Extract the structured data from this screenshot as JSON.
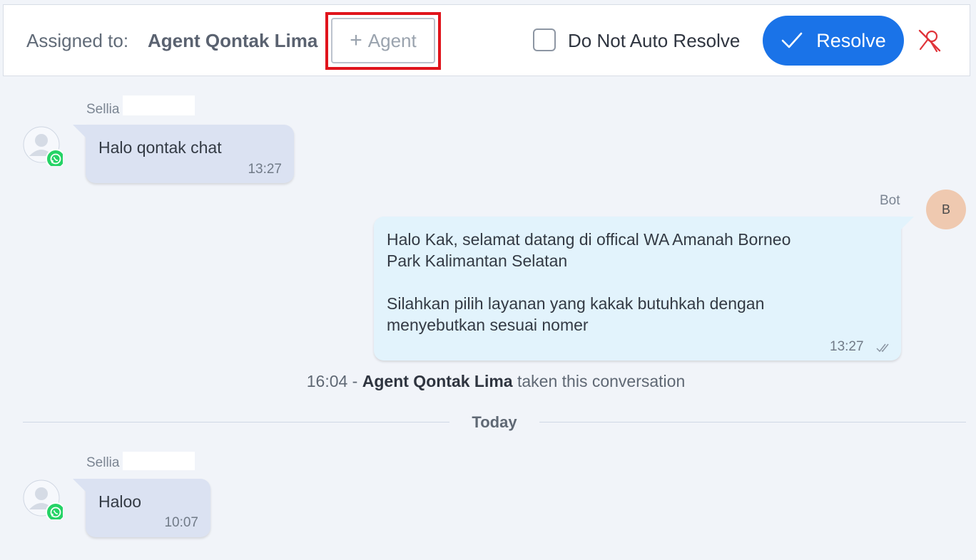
{
  "header": {
    "assigned_label": "Assigned to:",
    "assigned_agent": "Agent Qontak Lima",
    "add_agent_plus": "+",
    "add_agent_label": "Agent",
    "do_not_auto_resolve_label": "Do Not Auto Resolve",
    "do_not_auto_resolve_checked": false,
    "resolve_label": "Resolve",
    "accent_color": "#1a73e8",
    "highlight_color": "#e0141c",
    "icons": [
      "check-icon",
      "unassign-agent-icon"
    ]
  },
  "messages": [
    {
      "sender": "Sellia",
      "direction": "incoming",
      "channel": "whatsapp",
      "text": "Halo qontak chat",
      "time": "13:27"
    },
    {
      "sender": "Bot",
      "avatar_initial": "B",
      "direction": "outgoing",
      "text": "Halo Kak, selamat datang di offical WA Amanah Borneo\nPark Kalimantan Selatan\n\nSilahkan pilih layanan yang kakak butuhkah dengan\nmenyebutkan sesuai nomer",
      "time": "13:27",
      "status": "read"
    },
    {
      "sender": "Sellia",
      "direction": "incoming",
      "channel": "whatsapp",
      "text": "Haloo",
      "time": "10:07"
    }
  ],
  "system_event": {
    "time": "16:04",
    "separator": " - ",
    "agent": "Agent Qontak Lima",
    "action": " taken this conversation"
  },
  "date_divider": "Today"
}
